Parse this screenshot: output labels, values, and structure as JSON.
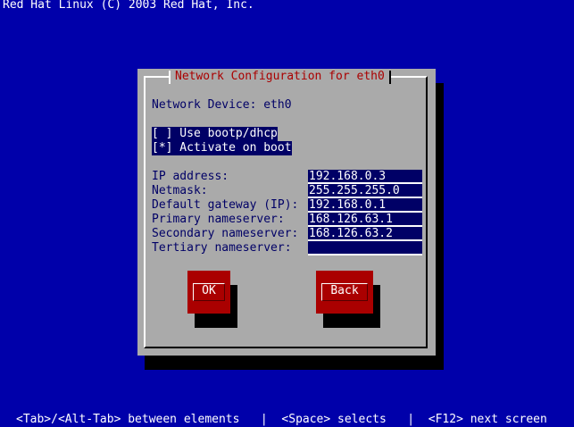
{
  "top_title": "Red Hat Linux (C) 2003 Red Hat, Inc.",
  "dialog": {
    "title": "Network Configuration for eth0",
    "device_label": "Network Device: eth0",
    "options": [
      {
        "text": "[ ] Use bootp/dhcp"
      },
      {
        "text": "[*] Activate on boot"
      }
    ],
    "fields": [
      {
        "label": "IP address:",
        "value": "192.168.0.3"
      },
      {
        "label": "Netmask:",
        "value": "255.255.255.0"
      },
      {
        "label": "Default gateway (IP):",
        "value": "192.168.0.1"
      },
      {
        "label": "Primary nameserver:",
        "value": "168.126.63.1"
      },
      {
        "label": "Secondary nameserver:",
        "value": "168.126.63.2"
      },
      {
        "label": "Tertiary nameserver:",
        "value": ""
      }
    ],
    "buttons": {
      "ok": "OK",
      "back": "Back"
    }
  },
  "help_bar": "<Tab>/<Alt-Tab> between elements   |  <Space> selects   |  <F12> next screen",
  "colors": {
    "background": "#0000aa",
    "dialog": "#aaaaaa",
    "title": "#aa0000",
    "field": "#000066",
    "button": "#aa0000"
  }
}
